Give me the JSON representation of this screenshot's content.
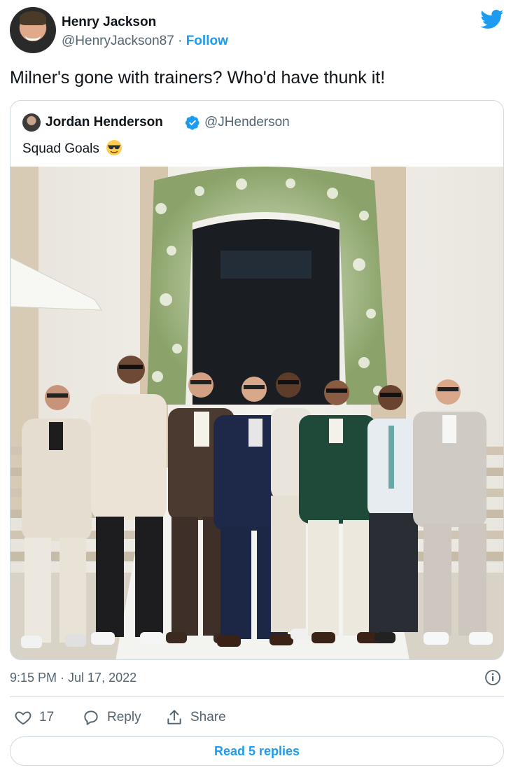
{
  "author": {
    "name": "Henry Jackson",
    "handle": "@HenryJackson87",
    "separator": "·",
    "follow_label": "Follow"
  },
  "tweet": {
    "text": "Milner's gone with trainers? Who'd have thunk it!",
    "timestamp": "9:15 PM · Jul 17, 2022"
  },
  "quoted": {
    "name": "Jordan Henderson",
    "handle": "@JHenderson",
    "text": "Squad Goals",
    "emoji_icon": "sunglasses-emoji-icon"
  },
  "actions": {
    "like_count": "17",
    "reply_label": "Reply",
    "share_label": "Share"
  },
  "read_replies_label": "Read 5 replies",
  "colors": {
    "accent": "#1d9bf0",
    "secondary_text": "#536471",
    "border": "#cfd9de"
  }
}
